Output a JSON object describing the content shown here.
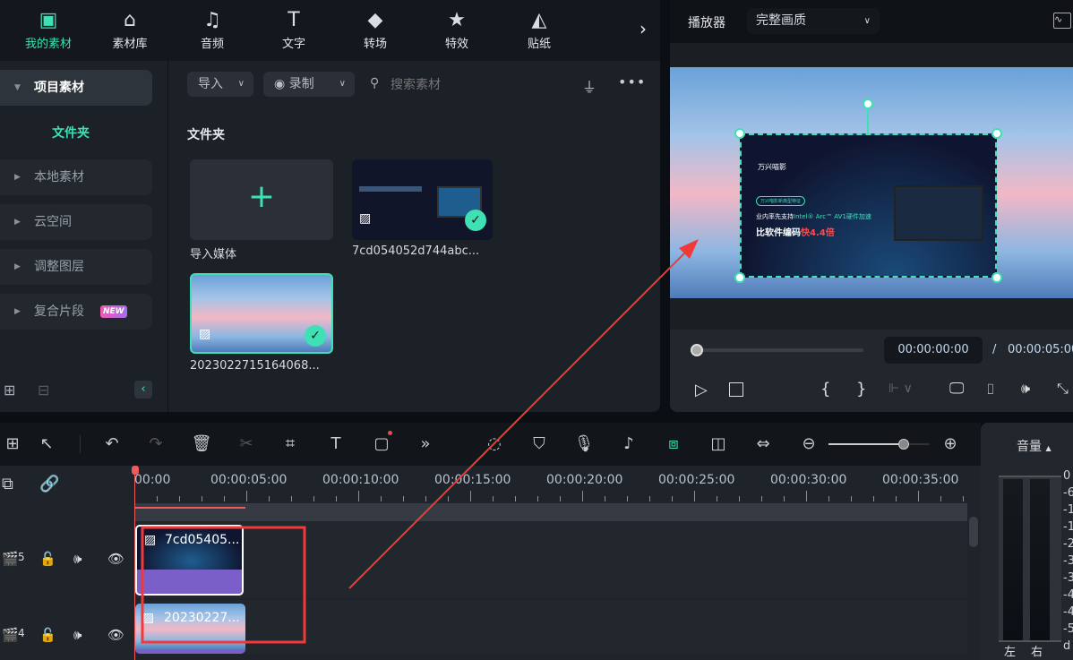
{
  "top_tabs": [
    {
      "label": "我的素材",
      "icon": "my-media-icon",
      "active": true
    },
    {
      "label": "素材库",
      "icon": "stock-library-icon"
    },
    {
      "label": "音频",
      "icon": "music-note-icon"
    },
    {
      "label": "文字",
      "icon": "text-t-icon"
    },
    {
      "label": "转场",
      "icon": "transition-icon"
    },
    {
      "label": "特效",
      "icon": "effects-star-icon"
    },
    {
      "label": "贴纸",
      "icon": "sticker-icon"
    }
  ],
  "sidebar": {
    "project_media": "项目素材",
    "folder": "文件夹",
    "items": [
      {
        "label": "本地素材"
      },
      {
        "label": "云空间"
      },
      {
        "label": "调整图层"
      },
      {
        "label": "复合片段",
        "badge": "NEW"
      }
    ]
  },
  "toolbar": {
    "import": "导入",
    "record": "录制",
    "search_placeholder": "搜索素材"
  },
  "media": {
    "section_title": "文件夹",
    "items": [
      {
        "label": "导入媒体",
        "type": "import"
      },
      {
        "label": "7cd054052d744abc...",
        "checked": true
      },
      {
        "label": "2023022715164068...",
        "checked": true,
        "selected": true
      }
    ]
  },
  "player": {
    "title": "播放器",
    "quality": "完整画质",
    "current_time": "00:00:00:00",
    "separator": "/",
    "total_time": "00:00:05:00",
    "progress": 0,
    "overlay": {
      "brand": "万兴喵影",
      "tag": "万兴喵影新典型特征",
      "line1_a": "业内率先支持",
      "line1_b": "Intel® Arc™ AV1硬件加速",
      "line2_a": "比软件编码",
      "line2_b": "快4.4倍"
    }
  },
  "timeline": {
    "ticks": [
      "00:00",
      "00:00:05:00",
      "00:00:10:00",
      "00:00:15:00",
      "00:00:20:00",
      "00:00:25:00",
      "00:00:30:00",
      "00:00:35:00"
    ],
    "zoom_level": 0.75,
    "tracks": [
      {
        "number": "5",
        "clip": "7cd05405..."
      },
      {
        "number": "4",
        "clip": "20230227..."
      }
    ]
  },
  "volume": {
    "title": "音量",
    "scale": [
      "0",
      "-6",
      "-1",
      "-1",
      "-2",
      "-3",
      "-3",
      "-4",
      "-4",
      "-5",
      "d"
    ],
    "left": "左",
    "right": "右"
  },
  "colors": {
    "accent": "#3ee0b4",
    "annotation": "#f03a3a",
    "clip_purple": "#7a5fc8"
  }
}
